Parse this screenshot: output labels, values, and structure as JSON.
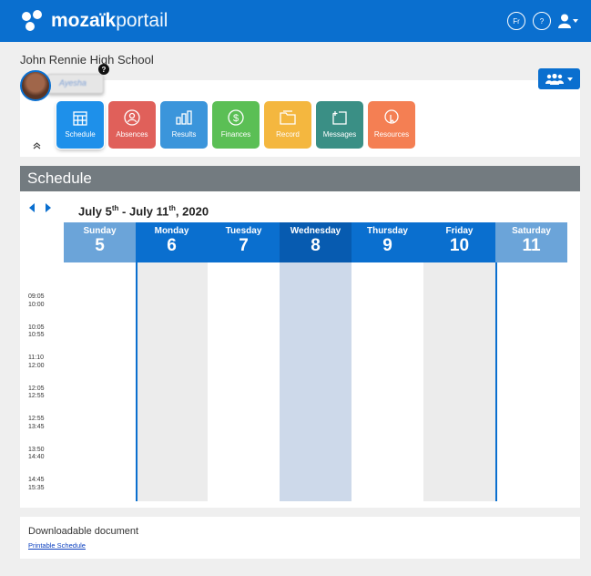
{
  "brand": {
    "bold": "mozaïk",
    "light": "portail"
  },
  "top_icons": {
    "language": "Fr",
    "help": "?"
  },
  "school_name": "John Rennie High School",
  "student_name": "Ayesha",
  "help_badge": "?",
  "tiles": [
    {
      "label": "Schedule",
      "color": "#1e90ea",
      "icon": "calendar-icon",
      "active": true
    },
    {
      "label": "Absences",
      "color": "#e0605a",
      "icon": "absence-icon"
    },
    {
      "label": "Results",
      "color": "#3b95db",
      "icon": "bar-chart-icon"
    },
    {
      "label": "Finances",
      "color": "#5bbf55",
      "icon": "dollar-icon"
    },
    {
      "label": "Record",
      "color": "#f4b73f",
      "icon": "folder-icon"
    },
    {
      "label": "Messages",
      "color": "#3a8f85",
      "icon": "message-icon"
    },
    {
      "label": "Resources",
      "color": "#f47f53",
      "icon": "resource-icon"
    }
  ],
  "schedule": {
    "title": "Schedule",
    "week": {
      "start": "July 5",
      "start_sup": "th",
      "sep": " - July 11",
      "end_sup": "th",
      "year": ", 2020"
    },
    "days": [
      {
        "name": "Sunday",
        "date": "5",
        "header_color": "#6ba4d9",
        "col_color": "#ffffff"
      },
      {
        "name": "Monday",
        "date": "6",
        "header_color": "#0a6fcf",
        "col_color": "#ececec"
      },
      {
        "name": "Tuesday",
        "date": "7",
        "header_color": "#0a6fcf",
        "col_color": "#ffffff"
      },
      {
        "name": "Wednesday",
        "date": "8",
        "header_color": "#075bb0",
        "col_color": "#cdd9ea"
      },
      {
        "name": "Thursday",
        "date": "9",
        "header_color": "#0a6fcf",
        "col_color": "#ffffff"
      },
      {
        "name": "Friday",
        "date": "10",
        "header_color": "#0a6fcf",
        "col_color": "#ececec"
      },
      {
        "name": "Saturday",
        "date": "11",
        "header_color": "#6ba4d9",
        "col_color": "#ffffff"
      }
    ],
    "periods": [
      [
        "09:05",
        "10:00"
      ],
      [
        "10:05",
        "10:55"
      ],
      [
        "11:10",
        "12:00"
      ],
      [
        "12:05",
        "12:55"
      ],
      [
        "12:55",
        "13:45"
      ],
      [
        "13:50",
        "14:40"
      ],
      [
        "14:45",
        "15:35"
      ]
    ]
  },
  "documents": {
    "title": "Downloadable document",
    "link": "Printable Schedule"
  }
}
